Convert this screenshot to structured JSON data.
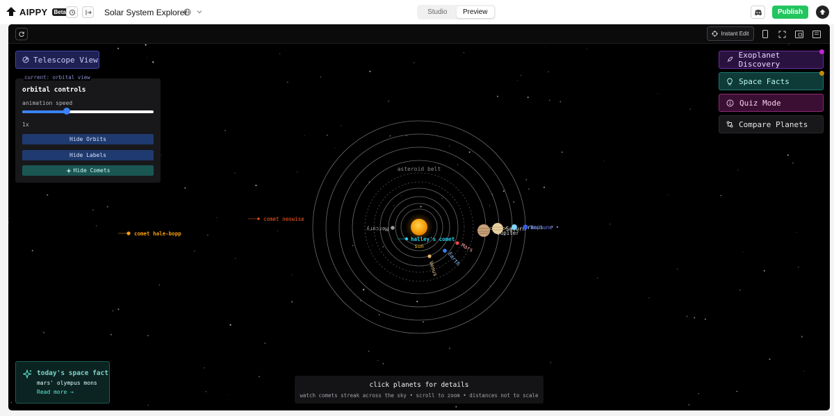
{
  "topbar": {
    "brand": "AIPPY",
    "beta_badge": "Beta",
    "project_title": "Solar System Explorer",
    "tabs": [
      {
        "label": "Studio",
        "active": false
      },
      {
        "label": "Preview",
        "active": true
      }
    ],
    "publish_label": "Publish",
    "icons": [
      "history-icon",
      "exit-icon",
      "globe-icon",
      "chevron-down-icon",
      "discord-icon",
      "avatar-icon"
    ]
  },
  "preview_toolbar": {
    "instant_edit_label": "Instant Edit",
    "icons": [
      "refresh-icon",
      "crosshair-icon",
      "phone-icon",
      "fullscreen-icon",
      "window-icon",
      "sidebar-icon"
    ]
  },
  "app": {
    "telescope_button": "Telescope View",
    "current_view": "current: orbital view",
    "controls": {
      "title": "orbital controls",
      "speed_label": "animation speed",
      "speed_fraction": 0.34,
      "speed_value": "1x",
      "buttons": [
        "Hide Orbits",
        "Hide Labels",
        "Hide Comets"
      ]
    },
    "side_buttons": [
      {
        "label": "Exoplanet Discovery",
        "icon": "rocket-icon"
      },
      {
        "label": "Space Facts",
        "icon": "lightbulb-icon"
      },
      {
        "label": "Quiz Mode",
        "icon": "quiz-icon"
      },
      {
        "label": "Compare Planets",
        "icon": "compare-icon"
      }
    ],
    "scene": {
      "sun_label": "sun",
      "belt_label": "asteroid belt",
      "planets": [
        "Mercury",
        "Venus",
        "Earth",
        "Mars",
        "Jupiter",
        "Saturn",
        "Uranus",
        "Neptune"
      ],
      "comets": [
        "halley's comet",
        "comet neowise",
        "comet hale-bopp"
      ]
    },
    "fact_card": {
      "title": "today's space fact",
      "body": "mars' olympus mons",
      "link": "Read more →"
    },
    "hint": {
      "title": "click planets for details",
      "subtitle": "watch comets streak across the sky • scroll to zoom • distances not to scale"
    }
  },
  "colors": {
    "publish": "#22c55e",
    "sun": "#f59e0b",
    "comet_cyan": "#22d3ee",
    "comet_orange": "#ff5a1f",
    "comet_amber": "#f59e0b"
  }
}
